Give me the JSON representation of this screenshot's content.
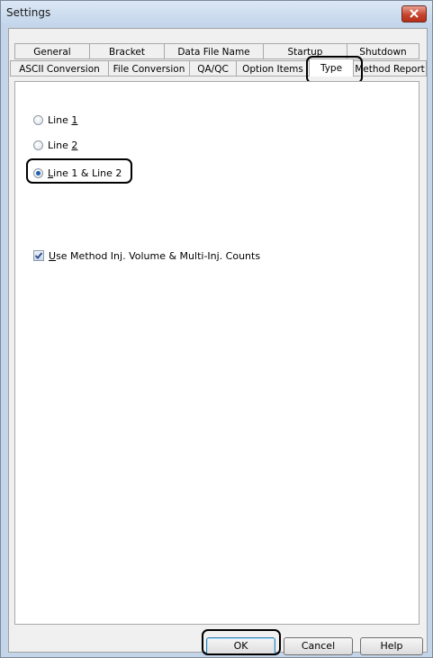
{
  "window": {
    "title": "Settings",
    "close_icon": "close-icon"
  },
  "tabs": {
    "row1": [
      "General",
      "Bracket",
      "Data File Name",
      "Startup",
      "Shutdown"
    ],
    "row2": [
      "ASCII Conversion",
      "File Conversion",
      "QA/QC",
      "Option Items",
      "Type",
      "Method Report"
    ],
    "active": "Type"
  },
  "options": {
    "radio1": {
      "prefix": "Line ",
      "mnemonic": "1",
      "suffix": "",
      "checked": false
    },
    "radio2": {
      "prefix": "Line ",
      "mnemonic": "2",
      "suffix": "",
      "checked": false
    },
    "radio3": {
      "prefix": "",
      "mnemonic": "L",
      "suffix": "ine 1 & Line 2",
      "checked": true
    },
    "checkbox": {
      "prefix": "",
      "mnemonic": "U",
      "suffix": "se Method Inj. Volume & Multi-Inj. Counts",
      "checked": true
    }
  },
  "buttons": {
    "ok": "OK",
    "cancel": "Cancel",
    "help": "Help"
  },
  "colors": {
    "titlebar": "#c4d5e9",
    "close": "#c7432d",
    "radio_dot": "#1f5fb0"
  }
}
